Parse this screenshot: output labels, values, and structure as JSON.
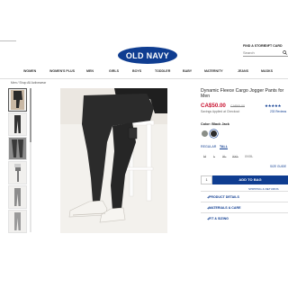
{
  "header": {
    "logo": "OLD NAVY",
    "find_store": "FIND A STORE",
    "gift_card": "GIFT CARD",
    "search_placeholder": "Search"
  },
  "nav": [
    "WOMEN",
    "WOMEN'S PLUS",
    "MEN",
    "GIRLS",
    "BOYS",
    "TODDLER",
    "BABY",
    "MATERNITY",
    "JEANS",
    "MASKS"
  ],
  "breadcrumb": "Men / Shop All Activewear",
  "product": {
    "title": "Dynamic Fleece Cargo Jogger Pants for Men",
    "price": "CA$50.00",
    "old_price": "CA$65.00",
    "savings": "Savings Applied at Checkout",
    "stars": "★★★★★",
    "reviews": "233 Reviews",
    "color_label": "Color: Black Jack",
    "fits": [
      "REGULAR",
      "TALL"
    ],
    "sizes": [
      "M",
      "L",
      "XL",
      "XXL",
      "XXXL"
    ],
    "size_guide": "SIZE GUIDE",
    "qty": "1",
    "add_to_bag": "ADD TO BAG",
    "shipping": "SHIPPING & RETURNS"
  },
  "accordions": [
    "PRODUCT DETAILS",
    "MATERIALS & CARE",
    "FIT & SIZING"
  ],
  "colors": {
    "brand": "#0f3d91",
    "sale": "#c8102e",
    "swatch_gray": "#8a8e87",
    "swatch_black": "#2b2b2b"
  }
}
